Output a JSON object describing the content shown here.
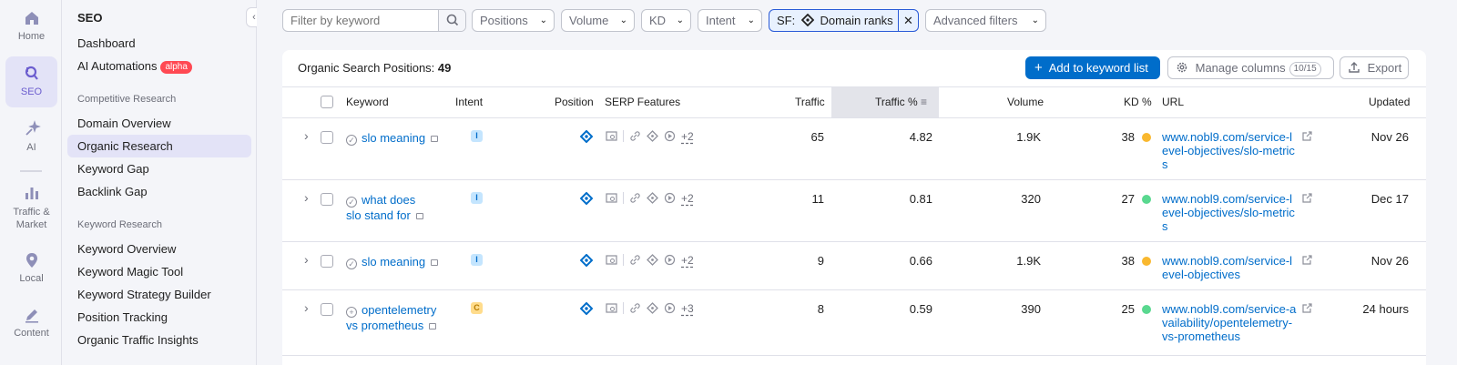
{
  "rail": [
    {
      "label": "Home",
      "icon": "home-icon"
    },
    {
      "label": "SEO",
      "icon": "seo-icon"
    },
    {
      "label": "AI",
      "icon": "ai-sparkle-icon"
    },
    {
      "label": "Traffic &",
      "label2": "Market",
      "icon": "bar-chart-icon"
    },
    {
      "label": "Local",
      "icon": "location-pin-icon"
    },
    {
      "label": "Content",
      "icon": "pen-icon"
    }
  ],
  "nav": {
    "title": "SEO",
    "top_items": [
      "Dashboard",
      "AI Automations"
    ],
    "alpha_badge": "alpha",
    "section1": "Competitive Research",
    "section1_items": [
      "Domain Overview",
      "Organic Research",
      "Keyword Gap",
      "Backlink Gap"
    ],
    "section2": "Keyword Research",
    "section2_items": [
      "Keyword Overview",
      "Keyword Magic Tool",
      "Keyword Strategy Builder",
      "Position Tracking",
      "Organic Traffic Insights"
    ]
  },
  "filters": {
    "search_placeholder": "Filter by keyword",
    "positions": "Positions",
    "volume": "Volume",
    "kd": "KD",
    "intent": "Intent",
    "sf_prefix": "SF:",
    "sf_value": "Domain ranks",
    "advanced": "Advanced filters"
  },
  "panel": {
    "title": "Organic Search Positions:",
    "count": "49",
    "add_button": "Add to keyword list",
    "manage_columns": "Manage columns",
    "columns_count": "10/15",
    "export": "Export"
  },
  "columns": {
    "keyword": "Keyword",
    "intent": "Intent",
    "position": "Position",
    "serp": "SERP Features",
    "traffic": "Traffic",
    "traffic_pct": "Traffic %",
    "volume": "Volume",
    "kd": "KD %",
    "url": "URL",
    "updated": "Updated"
  },
  "rows": [
    {
      "keyword": "slo meaning",
      "intent": "I",
      "serp_more": "+2",
      "traffic": "65",
      "traffic_pct": "4.82",
      "volume": "1.9K",
      "kd": "38",
      "kd_color": "#f9b82f",
      "url": "www.nobl9.com/service-level-objectives/slo-metrics",
      "updated": "Nov 26"
    },
    {
      "keyword": "what does slo stand for",
      "intent": "I",
      "serp_more": "+2",
      "traffic": "11",
      "traffic_pct": "0.81",
      "volume": "320",
      "kd": "27",
      "kd_color": "#59d88f",
      "url": "www.nobl9.com/service-level-objectives/slo-metrics",
      "updated": "Dec 17"
    },
    {
      "keyword": "slo meaning",
      "intent": "I",
      "serp_more": "+2",
      "traffic": "9",
      "traffic_pct": "0.66",
      "volume": "1.9K",
      "kd": "38",
      "kd_color": "#f9b82f",
      "url": "www.nobl9.com/service-level-objectives",
      "updated": "Nov 26"
    },
    {
      "keyword": "opentelemetry vs prometheus",
      "intent": "C",
      "serp_more": "+3",
      "traffic": "8",
      "traffic_pct": "0.59",
      "volume": "390",
      "kd": "25",
      "kd_color": "#59d88f",
      "url": "www.nobl9.com/service-availability/opentelemetry-vs-prometheus",
      "updated": "24 hours"
    }
  ]
}
